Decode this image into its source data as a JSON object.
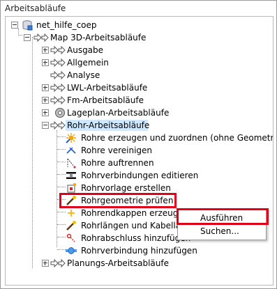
{
  "panel": {
    "title": "Arbeitsabläufe"
  },
  "tree": {
    "root": "net_hilfe_coep",
    "map": "Map 3D-Arbeitsabläufe",
    "categories": [
      "Ausgabe",
      "Allgemein",
      "Analyse",
      "LWL-Arbeitsabläufe",
      "Fm-Arbeitsabläufe",
      "Lageplan-Arbeitsabläufe"
    ],
    "selected": "Rohr-Arbeitsabläufe",
    "rohr_items": [
      "Rohre erzeugen und zuordnen (ohne Geometrie)",
      "Rohre vereinigen",
      "Rohre auftrennen",
      "Rohrverbindungen editieren",
      "Rohrvorlage erstellen",
      "Rohrgeometrie prüfen",
      "Rohrendkappen erzeugen",
      "Rohrlängen und Kabellänge",
      "Rohrabschluss hinzufügen",
      "Rohrverbindung hinzufügen"
    ],
    "last": "Planungs-Arbeitsabläufe"
  },
  "context_menu": {
    "run": "Ausführen",
    "search": "Suchen..."
  },
  "icons": {
    "root": "database-icon",
    "workflow": "workflow-arrow-icon",
    "lageplan": "lageplan-gear-icon",
    "rohr_erzeugen": "sun-spark-icon",
    "vereinigen": "join-icon",
    "auftrennen": "split-icon",
    "verbindungen": "connection-edit-icon",
    "vorlage": "template-icon",
    "pruefen": "check-wand-icon",
    "endkappen": "endcap-icon",
    "laengen": "length-icon",
    "abschluss": "termination-icon",
    "rohrverbindung": "pipe-connection-icon"
  },
  "colors": {
    "highlight": "#e0001a",
    "selection": "#cde8ff"
  }
}
